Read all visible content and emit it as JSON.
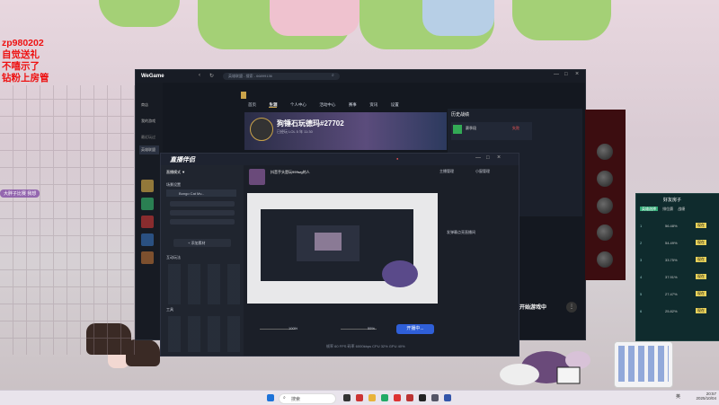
{
  "overlay_text": {
    "line1": "zp980202",
    "line2": "自觉送礼",
    "line3": "不嘻示了",
    "line4": "钻粉上房管"
  },
  "chat_line": "大胖子比赛 我想",
  "wegame": {
    "logo": "WeGame",
    "search_placeholder": "英雄联盟 - 搜索 - 66899136",
    "sidebar": [
      "商店",
      "我的游戏",
      "最近玩过",
      "英雄联盟"
    ],
    "tabs": [
      "首页",
      "生涯",
      "个人中心",
      "活动中心",
      "赛事",
      "资讯",
      "设置"
    ],
    "tab_active_index": 1,
    "player_name": "狗锤石玩德玛#27702",
    "player_sub": "已经玩 LOL 5 年 11:30",
    "recent_title": "历史战绩",
    "recent_item": "赛季段",
    "recent_status": "失败",
    "start_button": "开始游戏中"
  },
  "live_app": {
    "title": "直播伴侣",
    "left_heading": "直播模式 ▼",
    "scene_label": "场景设置",
    "scene_source": "Bongo Cat Mv...",
    "add_source": "+ 添加素材",
    "interact_label": "互动玩法",
    "tools_label": "工具",
    "stream_title": "抖音手头是玩999wg的人",
    "right_header_1": "主播管理",
    "right_header_2": "小窗管理",
    "chat_placeholder": "发弹幕点亮直播间",
    "footer_volume_1": "100%",
    "footer_volume_2": "55%",
    "go_live_button": "开播中...",
    "status_bar": "帧率 60 FPS  码率 6000kbps  CPU 32%  GPU 40%"
  },
  "rank_panel": {
    "title": "好友房子",
    "tabs": [
      "英雄选择",
      "排位赛",
      "战绩"
    ],
    "rows": [
      {
        "rank": "1",
        "pct": "56.48%",
        "tag": "现在"
      },
      {
        "rank": "2",
        "pct": "54.49%",
        "tag": "现在"
      },
      {
        "rank": "3",
        "pct": "33.75%",
        "tag": "现在"
      },
      {
        "rank": "4",
        "pct": "37.91%",
        "tag": "现在"
      },
      {
        "rank": "5",
        "pct": "27.47%",
        "tag": "现在"
      },
      {
        "rank": "6",
        "pct": "25.82%",
        "tag": "现在"
      }
    ]
  },
  "taskbar": {
    "search_placeholder": "搜索",
    "time": "20:57",
    "date": "2025/10/04",
    "lang": "英"
  },
  "colors": {
    "accent_blue": "#2f5fd8",
    "overlay_red": "#e11111",
    "wegame_bg": "#141820",
    "live_bg": "#1b1f28"
  }
}
